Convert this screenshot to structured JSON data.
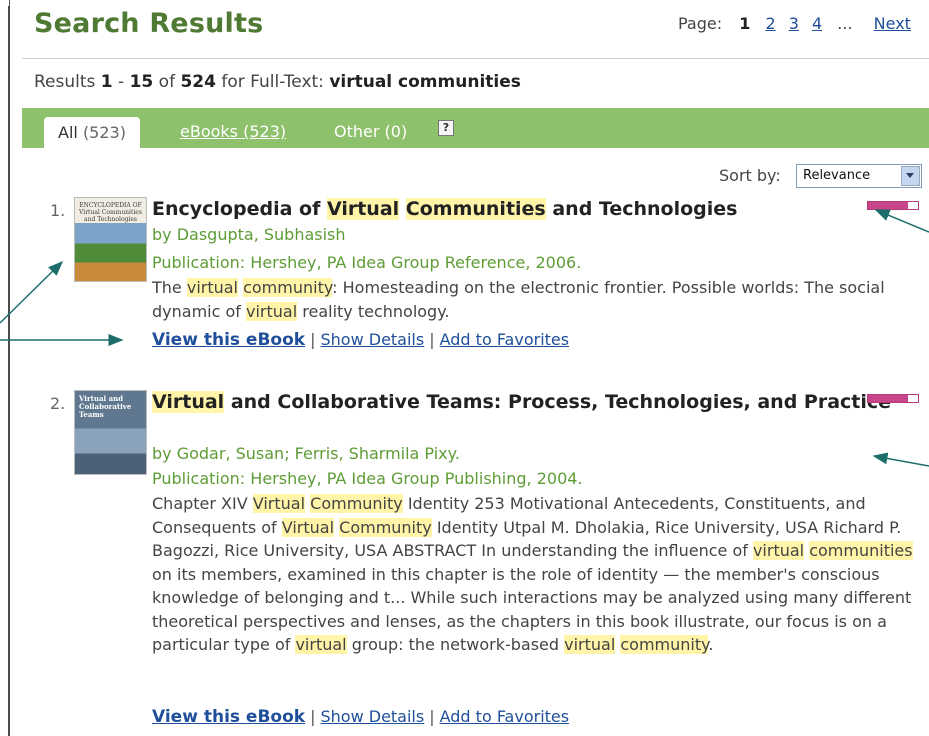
{
  "header": {
    "title": "Search Results",
    "pager": {
      "label": "Page:",
      "current": "1",
      "pages": [
        "2",
        "3",
        "4"
      ],
      "ellipsis": "...",
      "next": "Next"
    }
  },
  "summary": {
    "prefix": "Results",
    "from": "1",
    "dash": "-",
    "to": "15",
    "of": "of",
    "total": "524",
    "for_label": "for Full-Text:",
    "query": "virtual communities"
  },
  "tabs": {
    "all": {
      "label": "All",
      "count": "(523)"
    },
    "ebooks": "eBooks (523)",
    "other": "Other (0)",
    "help": "?"
  },
  "sort": {
    "label": "Sort by:",
    "selected": "Relevance"
  },
  "results": [
    {
      "number": "1.",
      "thumb_text": "ENCYCLOPEDIA OF Virtual Communities and Technologies",
      "title_parts": [
        "Encyclopedia of ",
        "Virtual",
        " ",
        "Communities",
        " and Technologies"
      ],
      "author": "by Dasgupta, Subhasish",
      "publication": "Publication: Hershey, PA Idea Group Reference, 2006.",
      "snippet_parts": [
        "The ",
        "virtual",
        " ",
        "community",
        ": Homesteading on the electronic frontier. Possible worlds: The social dynamic of ",
        "virtual",
        " reality technology."
      ],
      "relevance": 0.8
    },
    {
      "number": "2.",
      "thumb_text": "Virtual and Collaborative Teams",
      "title_parts": [
        "Virtual",
        " and Collaborative Teams: Process, Technologies, and Practice"
      ],
      "author": "by Godar, Susan; Ferris, Sharmila Pixy.",
      "publication": "Publication: Hershey, PA Idea Group Publishing, 2004.",
      "snippet_parts": [
        "Chapter XIV ",
        "Virtual",
        " ",
        "Community",
        " Identity 253 Motivational Antecedents, Constituents, and Consequents of ",
        "Virtual",
        " ",
        "Community",
        " Identity Utpal M. Dholakia, Rice University, USA Richard P. Bagozzi, Rice University, USA ABSTRACT In understanding the influence of ",
        "virtual",
        " ",
        "communities",
        " on its members, examined in this chapter is the role of identity — the member's conscious knowledge of belonging and t... While such interactions may be analyzed using many different theoretical perspectives and lenses, as the chapters in this book illustrate, our focus is on a particular type of ",
        "virtual",
        " group: the network-based ",
        "virtual",
        " ",
        "community",
        "."
      ],
      "relevance": 0.8
    }
  ],
  "actions": {
    "view": "View this eBook",
    "details": "Show Details",
    "favorites": "Add to Favorites",
    "separator": "|"
  },
  "colors": {
    "title_green": "#4f7a33",
    "tab_green": "#8dc16b",
    "link_blue": "#1f4f9a",
    "highlight": "#fff4a8",
    "relevance": "#c7458a",
    "arrow": "#1d6d6b"
  }
}
